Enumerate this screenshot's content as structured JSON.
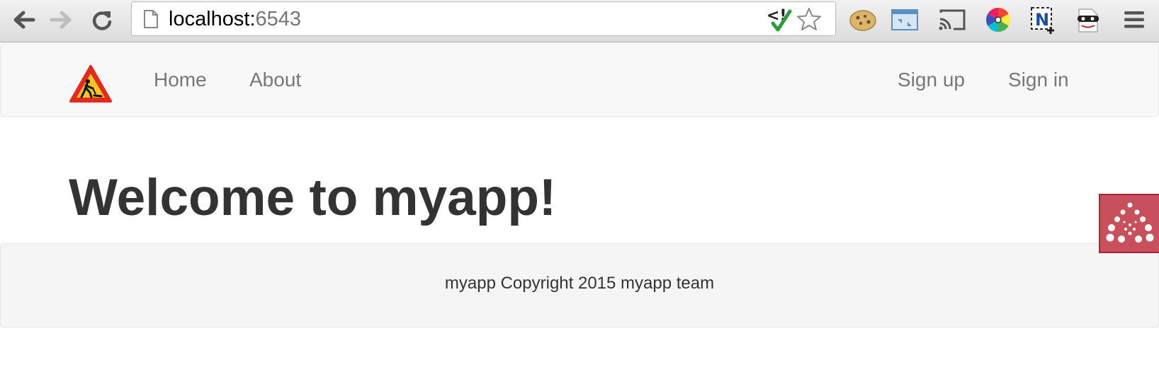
{
  "browser": {
    "url_host": "localhost:",
    "url_port": "6543",
    "icons": {
      "back": "back-arrow-icon",
      "forward": "forward-arrow-icon",
      "reload": "reload-icon",
      "page": "page-icon",
      "bookmark": "bookmark-star-icon"
    },
    "extensions": [
      "validator-check-icon",
      "cookie-icon",
      "window-resize-icon",
      "cast-icon",
      "color-wheel-icon",
      "n-snippet-icon",
      "incognito-mask-icon",
      "menu-icon"
    ]
  },
  "navbar": {
    "brand_icon": "under-construction-icon",
    "home_label": "Home",
    "about_label": "About",
    "signup_label": "Sign up",
    "signin_label": "Sign in"
  },
  "main": {
    "title": "Welcome to myapp!"
  },
  "footer": {
    "text": "myapp Copyright 2015 myapp team"
  },
  "debug_toolbar": {
    "icon": "pyramid-debug-icon",
    "color": "#c7505c"
  }
}
